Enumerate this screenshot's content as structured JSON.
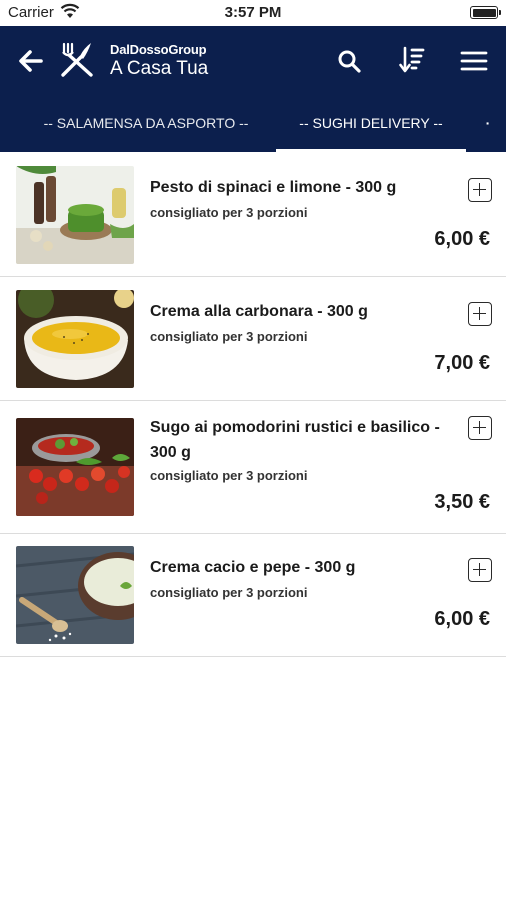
{
  "status_bar": {
    "carrier": "Carrier",
    "time": "3:57 PM"
  },
  "header": {
    "brand_small": "DalDossoGroup",
    "title": "A Casa Tua",
    "background_color": "#0c1f4d",
    "icons": [
      "back-arrow-icon",
      "fork-knife-icon",
      "search-icon",
      "sort-icon",
      "hamburger-menu-icon"
    ]
  },
  "tabs": [
    {
      "label": "-- SALAMENSA DA ASPORTO --",
      "selected": false
    },
    {
      "label": "-- SUGHI DELIVERY --",
      "selected": true
    },
    {
      "label": "·",
      "selected": false
    }
  ],
  "products": [
    {
      "name": "Pesto di spinaci e limone - 300 g",
      "subtitle": "consigliato per 3 porzioni",
      "price": "6,00 €",
      "image": "pesto-photo"
    },
    {
      "name": "Crema alla carbonara - 300 g",
      "subtitle": "consigliato per 3 porzioni",
      "price": "7,00 €",
      "image": "carbonara-cream-photo"
    },
    {
      "name": "Sugo ai pomodorini rustici e basilico - 300 g",
      "subtitle": "consigliato per 3 porzioni",
      "price": "3,50 €",
      "image": "cherry-tomato-sauce-photo"
    },
    {
      "name": "Crema cacio e pepe - 300 g",
      "subtitle": "consigliato per 3 porzioni",
      "price": "6,00 €",
      "image": "cacio-pepe-cream-photo"
    }
  ]
}
